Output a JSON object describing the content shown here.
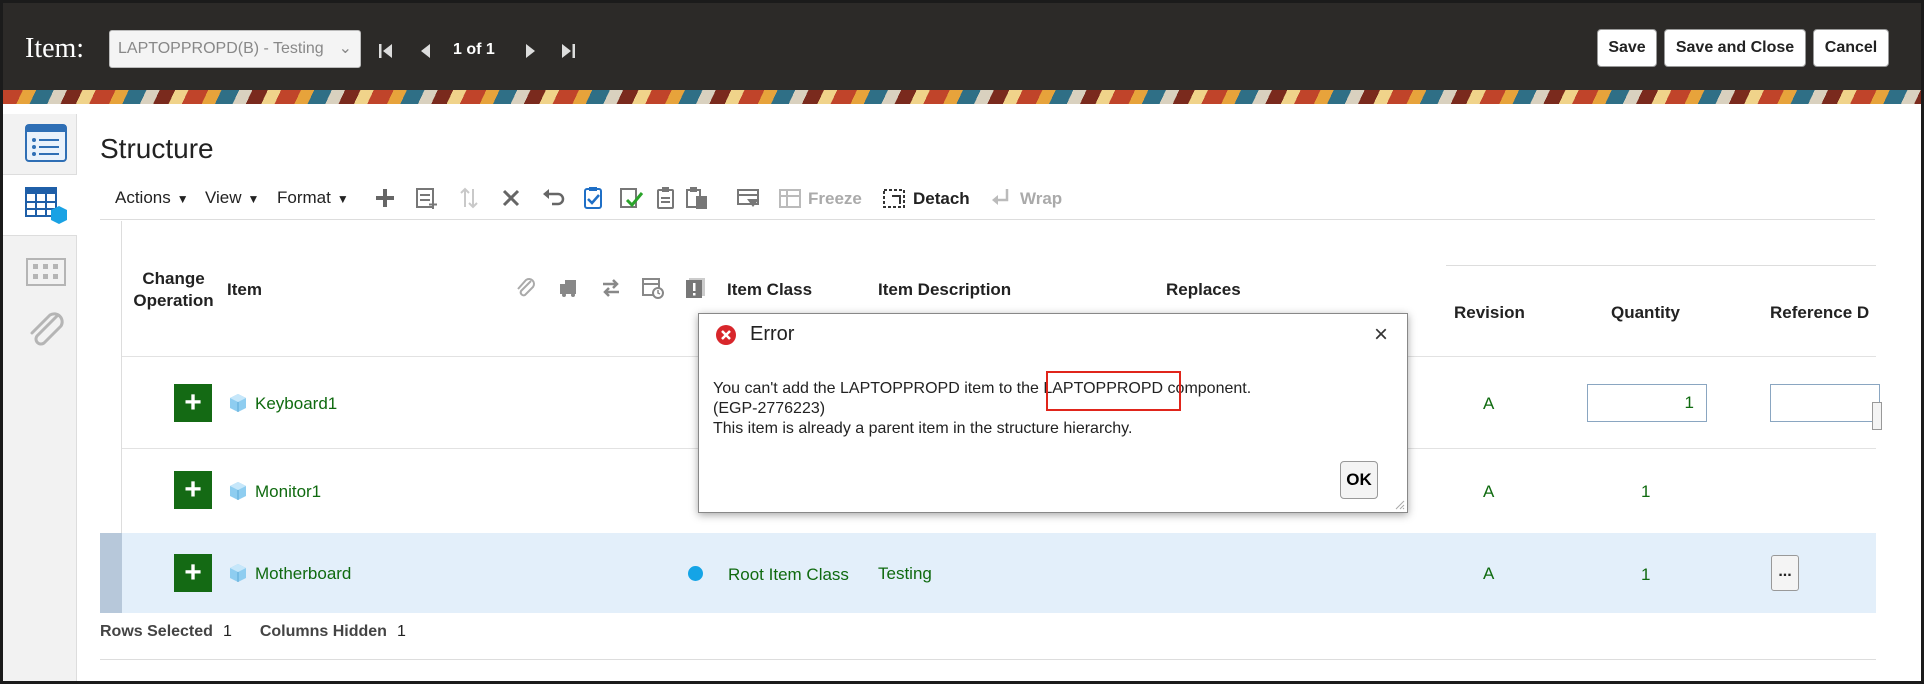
{
  "header": {
    "title": "Item:",
    "item_selector": "LAPTOPPROPD(B) - Testing",
    "pager": "1 of 1",
    "save": "Save",
    "save_and_close": "Save and Close",
    "cancel": "Cancel"
  },
  "page": {
    "title": "Structure"
  },
  "toolbar": {
    "actions": "Actions",
    "view": "View",
    "format": "Format",
    "freeze": "Freeze",
    "detach": "Detach",
    "wrap": "Wrap"
  },
  "table": {
    "columns": {
      "change_operation": "Change Operation",
      "item": "Item",
      "item_class": "Item Class",
      "item_description": "Item Description",
      "replaces": "Replaces",
      "revision": "Revision",
      "quantity": "Quantity",
      "reference": "Reference D"
    },
    "rows": [
      {
        "item": "Keyboard1",
        "item_class": "",
        "description": "",
        "revision": "A",
        "quantity": "1"
      },
      {
        "item": "Monitor1",
        "item_class": "",
        "description": "",
        "revision": "A",
        "quantity": "1"
      },
      {
        "item": "Motherboard",
        "item_class": "Root Item Class",
        "description": "Testing",
        "revision": "A",
        "quantity": "1",
        "reference_button": "..."
      }
    ]
  },
  "footer": {
    "rows_selected_label": "Rows Selected",
    "rows_selected_value": "1",
    "columns_hidden_label": "Columns Hidden",
    "columns_hidden_value": "1"
  },
  "dialog": {
    "title": "Error",
    "line1_before": "You can't add the LAPTOPPROPD item to the ",
    "line1_highlight": "LAPTOPPROPD",
    "line1_after": " component.",
    "line2": "(EGP-2776223)",
    "line3": "This item is already a parent item in the structure hierarchy.",
    "ok": "OK",
    "close": "×"
  },
  "colors": {
    "header_bg": "#2c2a28",
    "add_green": "#146a14",
    "link_green": "#0f6a0f",
    "error_red": "#e0251b",
    "selected_row": "#e3effa"
  }
}
